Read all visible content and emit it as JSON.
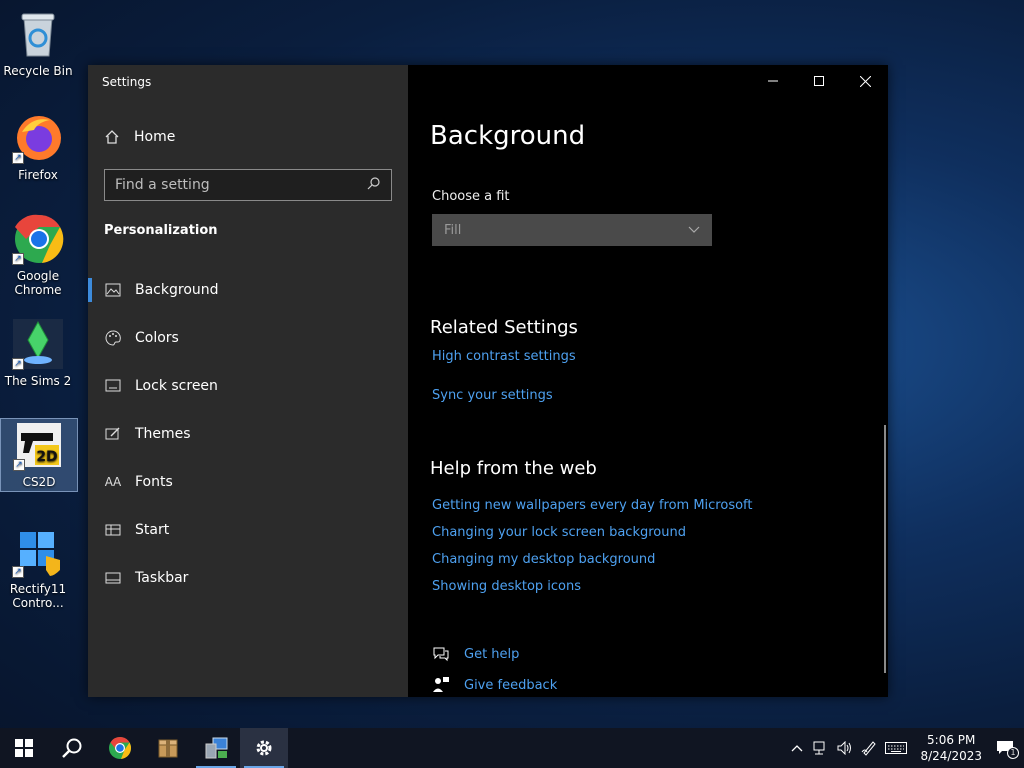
{
  "desktop": {
    "icons": [
      {
        "label": "Recycle Bin"
      },
      {
        "label": "Firefox"
      },
      {
        "label": "Google Chrome"
      },
      {
        "label": "The Sims 2"
      },
      {
        "label": "CS2D"
      },
      {
        "label": "Rectify11 Contro..."
      }
    ]
  },
  "window": {
    "title": "Settings",
    "nav": {
      "home": "Home",
      "search_placeholder": "Find a setting",
      "section": "Personalization",
      "items": [
        {
          "label": "Background",
          "icon": "picture-icon"
        },
        {
          "label": "Colors",
          "icon": "palette-icon"
        },
        {
          "label": "Lock screen",
          "icon": "lock-screen-icon"
        },
        {
          "label": "Themes",
          "icon": "themes-icon"
        },
        {
          "label": "Fonts",
          "icon": "fonts-icon"
        },
        {
          "label": "Start",
          "icon": "start-icon"
        },
        {
          "label": "Taskbar",
          "icon": "taskbar-icon"
        }
      ]
    },
    "content": {
      "title": "Background",
      "fit_label": "Choose a fit",
      "fit_value": "Fill",
      "related_title": "Related Settings",
      "related_links": [
        "High contrast settings",
        "Sync your settings"
      ],
      "help_title": "Help from the web",
      "help_links": [
        "Getting new wallpapers every day from Microsoft",
        "Changing your lock screen background",
        "Changing my desktop background",
        "Showing desktop icons"
      ],
      "get_help": "Get help",
      "give_feedback": "Give feedback"
    }
  },
  "taskbar": {
    "time": "5:06 PM",
    "date": "8/24/2023",
    "notification_count": "1"
  },
  "colors": {
    "accent": "#3d8bdb",
    "link": "#4ea1f0"
  }
}
